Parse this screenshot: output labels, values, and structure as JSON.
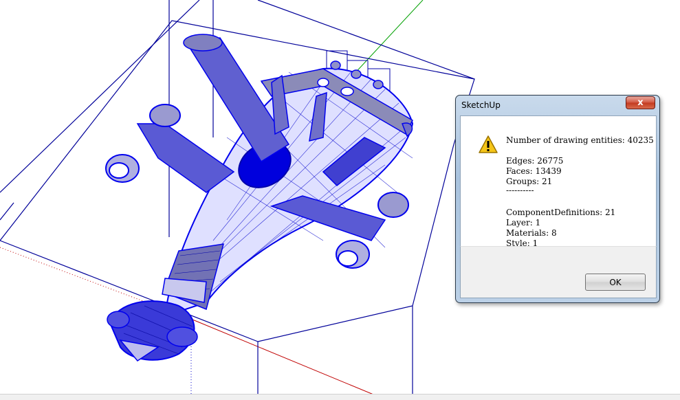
{
  "dialog": {
    "title": "SketchUp",
    "close_label": "x",
    "lines": [
      "Number of drawing entities: 40235",
      "Edges: 26775",
      "Faces: 13439",
      "Groups: 21",
      "----------",
      "ComponentDefinitions: 21",
      "Layer: 1",
      "Materials: 8",
      "Style: 1"
    ],
    "ok_label": "OK",
    "icon": "warning-icon"
  },
  "viewport": {
    "model_color": "#0000ee",
    "box_color": "#000099",
    "axis_red": "#c00000",
    "axis_green": "#00a000"
  }
}
